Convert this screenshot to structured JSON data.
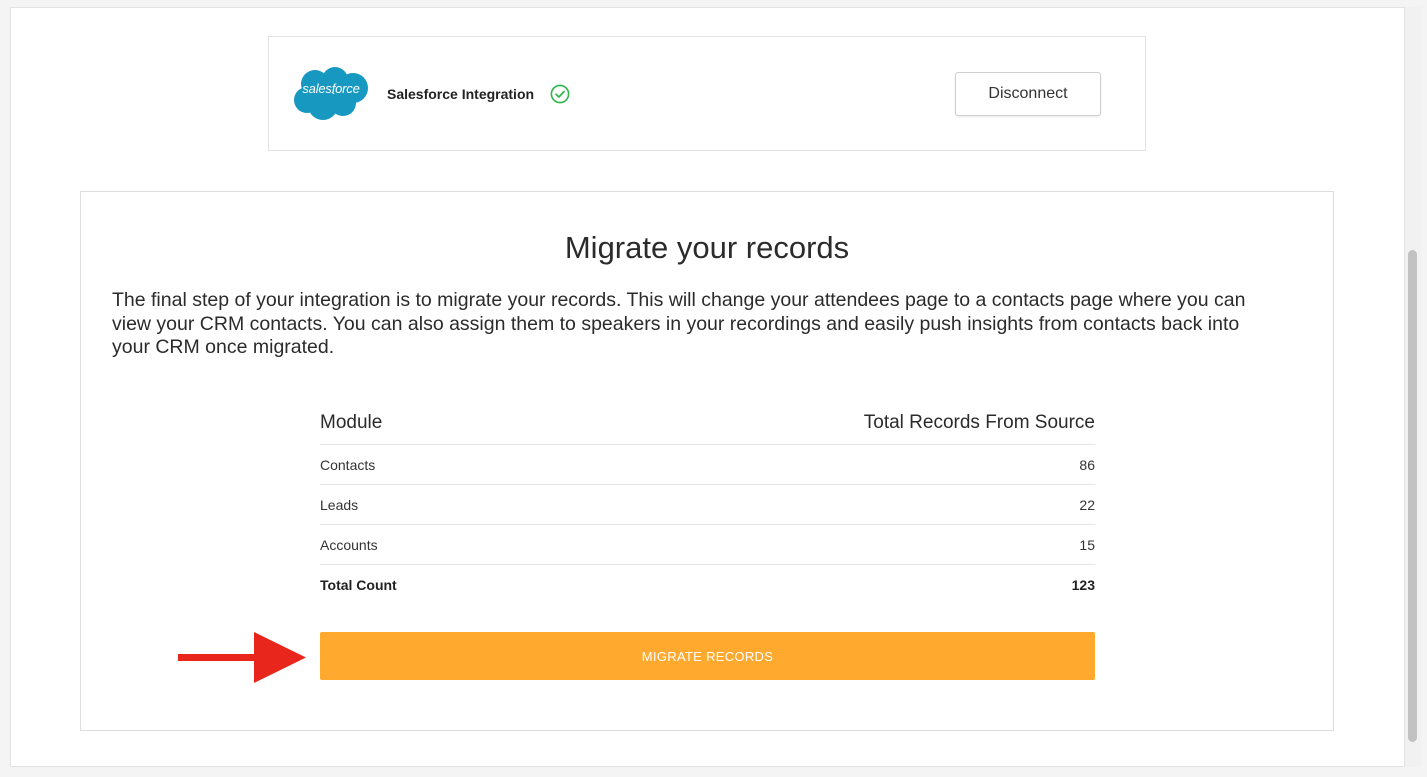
{
  "integration": {
    "logo_text": "salesforce",
    "name": "Salesforce Integration",
    "disconnect_label": "Disconnect",
    "logo_color": "#1798c1",
    "connected_color": "#2eb44a"
  },
  "migrate": {
    "title": "Migrate your records",
    "description": "The final step of your integration is to migrate your records. This will change your attendees page to a contacts page where you can view your CRM contacts. You can also assign them to speakers in your recordings and easily push insights from contacts back into your CRM once migrated.",
    "table": {
      "headers": [
        "Module",
        "Total Records From Source"
      ],
      "rows": [
        {
          "module": "Contacts",
          "count": "86"
        },
        {
          "module": "Leads",
          "count": "22"
        },
        {
          "module": "Accounts",
          "count": "15"
        }
      ],
      "total": {
        "label": "Total Count",
        "count": "123"
      }
    },
    "button_label": "MIGRATE RECORDS",
    "button_color": "#ffa92e",
    "arrow_color": "#e8261c"
  }
}
